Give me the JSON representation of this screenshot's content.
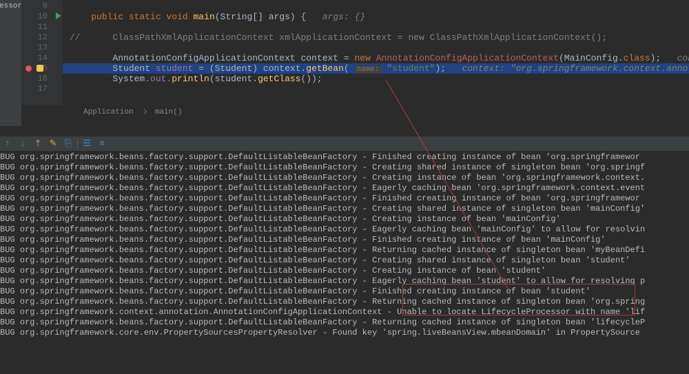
{
  "sidetab": "essor",
  "gutter_start": 9,
  "gutter_count": 9,
  "run_on_line": 10,
  "breakpoint_line": 15,
  "bulb_line": 15,
  "highlight_line": 15,
  "code": {
    "l9": {
      "text": ""
    },
    "l10": {
      "kw1": "public",
      "kw2": "static",
      "kw3": "void",
      "m": "main",
      "args": "(String[] args) {",
      "hint": "args: {}"
    },
    "l11": {
      "text": ""
    },
    "l12": {
      "c": "//",
      "body": "ClassPathXmlApplicationContext xmlApplicationContext = new ClassPathXmlApplicationContext();"
    },
    "l13": {
      "text": ""
    },
    "l14": {
      "cls": "AnnotationConfigApplicationContext",
      "var": "context",
      "eq": " = ",
      "kw": "new",
      "ann": "AnnotationConfigApplicationContext",
      "arg": "(MainConfig.",
      "fld": "class",
      "end": ");",
      "tail": "conte"
    },
    "l15": {
      "cls": "Student",
      "var": "student",
      "eq": " = (",
      "cast": "Student",
      "close": ") context.",
      "m": "getBean",
      "open": "(",
      "hint": "name:",
      "str": "\"student\"",
      "close2": ");",
      "ctx": "context: \"org.springframework.context.annotation"
    },
    "l16": {
      "sys": "System",
      "out": ".out.",
      "m": "println",
      "open": "(student.",
      "m2": "getClass",
      "end": "());"
    },
    "l17": {
      "text": ""
    }
  },
  "breadcrumb": {
    "a": "Application",
    "b": "main()"
  },
  "toolbar_icons": [
    "↑",
    "↓",
    "⤒",
    "✎",
    "⎘",
    "☰",
    "≡"
  ],
  "log_prefix": "BUG ",
  "log_class": "org.springframework.beans.factory.support.DefaultListableBeanFactory",
  "log_class2": "org.springframework.context.annotation.AnnotationConfigApplicationContext",
  "log_class3": "org.springframework.core.env.PropertySourcesPropertyResolver",
  "logs": [
    "Finished creating instance of bean 'org.springframewor",
    "Creating shared instance of singleton bean 'org.springf",
    "Creating instance of bean 'org.springframework.context.",
    "Eagerly caching bean 'org.springframework.context.event",
    "Finished creating instance of bean 'org.springframewor",
    "Creating shared instance of singleton bean 'mainConfig'",
    "Creating instance of bean 'mainConfig'",
    "Eagerly caching bean 'mainConfig' to allow for resolvin",
    "Finished creating instance of bean 'mainConfig'",
    "Returning cached instance of singleton bean 'myBeanDefi",
    "Creating shared instance of singleton bean 'student'",
    "Creating instance of bean 'student'",
    "Eagerly caching bean 'student' to allow for resolving p",
    "Finished creating instance of bean 'student'",
    "Returning cached instance of singleton bean 'org.spring"
  ],
  "log_special1": "Unable to locate LifecycleProcessor with name 'lif",
  "log_special2": "Returning cached instance of singleton bean 'lifecycleP",
  "log_special3": "Found key 'spring.liveBeansView.mbeanDomain' in PropertySource ",
  "highlight_box_text": "Finished creating instance of bean 'student'"
}
